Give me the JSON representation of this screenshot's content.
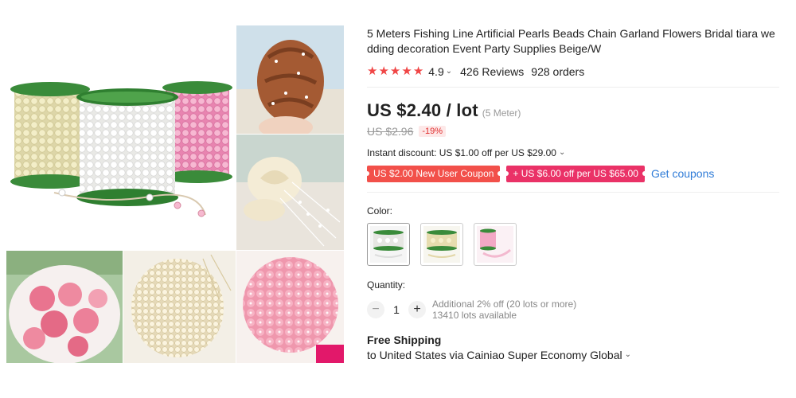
{
  "product": {
    "title": "5 Meters Fishing Line Artificial Pearls Beads Chain Garland Flowers Bridal tiara wedding decoration Event Party Supplies Beige/W",
    "rating_value": "4.9",
    "stars": 5,
    "reviews": "426 Reviews",
    "orders": "928 orders"
  },
  "price": {
    "current": "US $2.40 / lot",
    "unit": "(5 Meter)",
    "original": "US $2.96",
    "discount": "-19%"
  },
  "promo": {
    "instant_discount": "Instant discount: US $1.00 off per US $29.00",
    "coupon_new_user": "US $2.00 New User Coupon",
    "coupon_store": "+ US $6.00 off per US $65.00",
    "get_coupons": "Get coupons"
  },
  "options": {
    "color_label": "Color:",
    "color_swatches": [
      "green-white",
      "beige",
      "pink"
    ]
  },
  "quantity": {
    "label": "Quantity:",
    "minus": "−",
    "value": "1",
    "plus": "+",
    "note_line1": "Additional 2% off (20 lots or more)",
    "note_line2": "13410 lots available"
  },
  "shipping": {
    "title": "Free Shipping",
    "destination": "to United States via Cainiao Super Economy Global"
  },
  "colors": {
    "star": "#f04646",
    "coupon_red": "#f2504a",
    "coupon_pink": "#ea3267",
    "link_blue": "#2e7bd7"
  },
  "icons": {
    "star": "star-icon",
    "chevron": "chevron-down-icon"
  }
}
